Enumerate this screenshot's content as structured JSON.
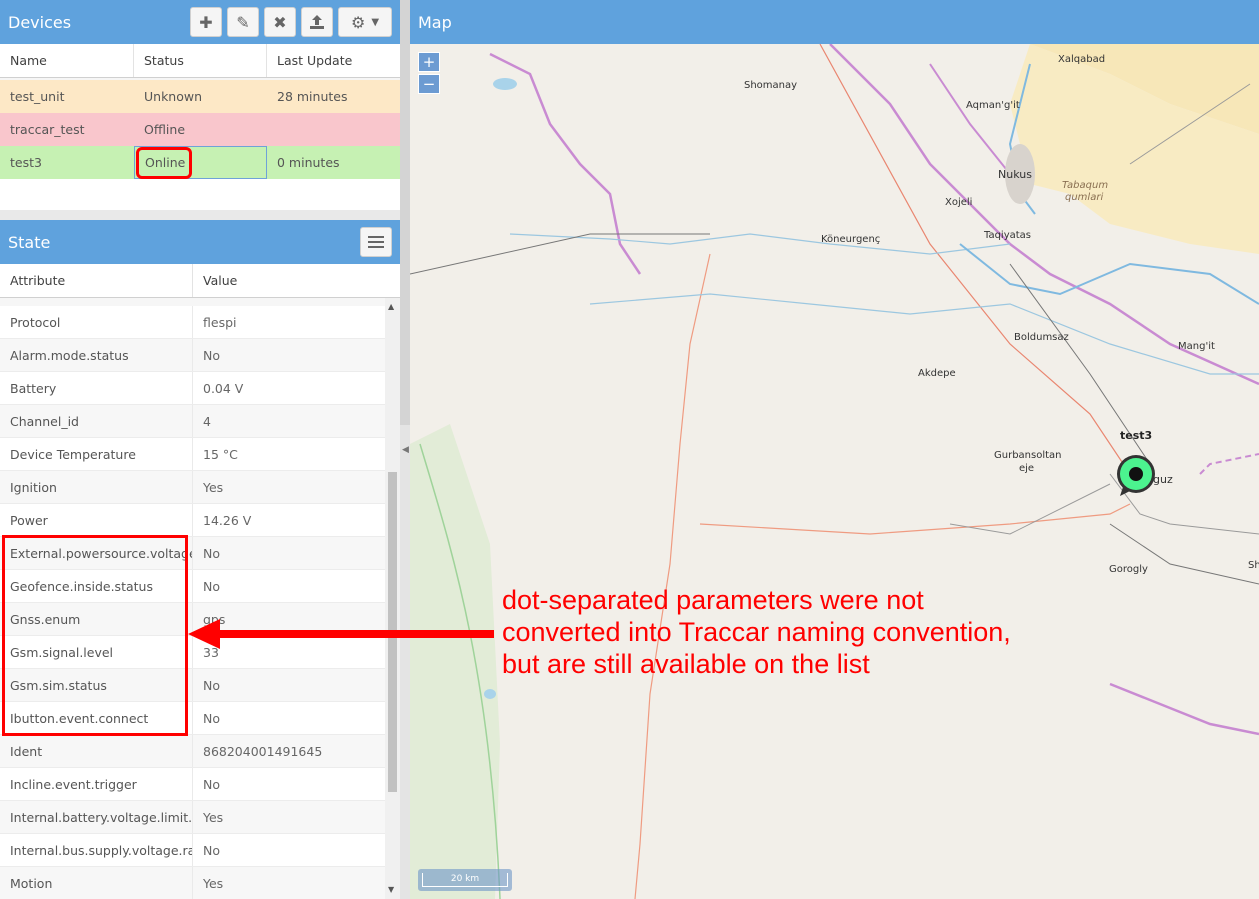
{
  "devices": {
    "title": "Devices",
    "columns": [
      "Name",
      "Status",
      "Last Update"
    ],
    "rows": [
      {
        "name": "test_unit",
        "status": "Unknown",
        "last_update": "28 minutes"
      },
      {
        "name": "traccar_test",
        "status": "Offline",
        "last_update": ""
      },
      {
        "name": "test3",
        "status": "Online",
        "last_update": "0 minutes"
      }
    ],
    "toolbar_icons": [
      "add-icon",
      "edit-icon",
      "remove-icon",
      "upload-icon",
      "settings-icon"
    ]
  },
  "state": {
    "title": "State",
    "columns": [
      "Attribute",
      "Value"
    ],
    "rows": [
      {
        "attr": "Protocol",
        "value": "flespi"
      },
      {
        "attr": "Alarm.mode.status",
        "value": "No"
      },
      {
        "attr": "Battery",
        "value": "0.04 V"
      },
      {
        "attr": "Channel_id",
        "value": "4"
      },
      {
        "attr": "Device Temperature",
        "value": "15 °C"
      },
      {
        "attr": "Ignition",
        "value": "Yes"
      },
      {
        "attr": "Power",
        "value": "14.26 V"
      },
      {
        "attr": "External.powersource.voltage.limit",
        "value": "No"
      },
      {
        "attr": "Geofence.inside.status",
        "value": "No"
      },
      {
        "attr": "Gnss.enum",
        "value": "gps"
      },
      {
        "attr": "Gsm.signal.level",
        "value": "33"
      },
      {
        "attr": "Gsm.sim.status",
        "value": "No"
      },
      {
        "attr": "Ibutton.event.connect",
        "value": "No"
      },
      {
        "attr": "Ident",
        "value": "868204001491645"
      },
      {
        "attr": "Incline.event.trigger",
        "value": "No"
      },
      {
        "attr": "Internal.battery.voltage.limit.status",
        "value": "Yes"
      },
      {
        "attr": "Internal.bus.supply.voltage.range.outside.status",
        "value": "No"
      },
      {
        "attr": "Motion",
        "value": "Yes"
      }
    ]
  },
  "map": {
    "title": "Map",
    "zoom_in": "+",
    "zoom_out": "−",
    "scale": "20 km",
    "marker_label": "test3",
    "places": [
      "Xalqabad",
      "Shomanay",
      "Aqman'g'it",
      "Nukus",
      "Tabaqum",
      "qumlari",
      "Xojeli",
      "Köneurgenç",
      "Taqiyatas",
      "Boldumsaz",
      "Mang'it",
      "Akdepe",
      "Gurbansoltan",
      "eje",
      "guz",
      "Gorogly",
      "Sh"
    ]
  },
  "annotation": {
    "lines": [
      "dot-separated parameters were not",
      "converted into Traccar naming convention,",
      "but are still available on the list"
    ]
  },
  "colors": {
    "header_blue": "#5fa2dd",
    "row_unknown": "#fde8c6",
    "row_offline": "#f9c6cc",
    "row_online": "#c6f1b3",
    "annotation_red": "#ff0000",
    "marker_green": "#4cf38f"
  }
}
